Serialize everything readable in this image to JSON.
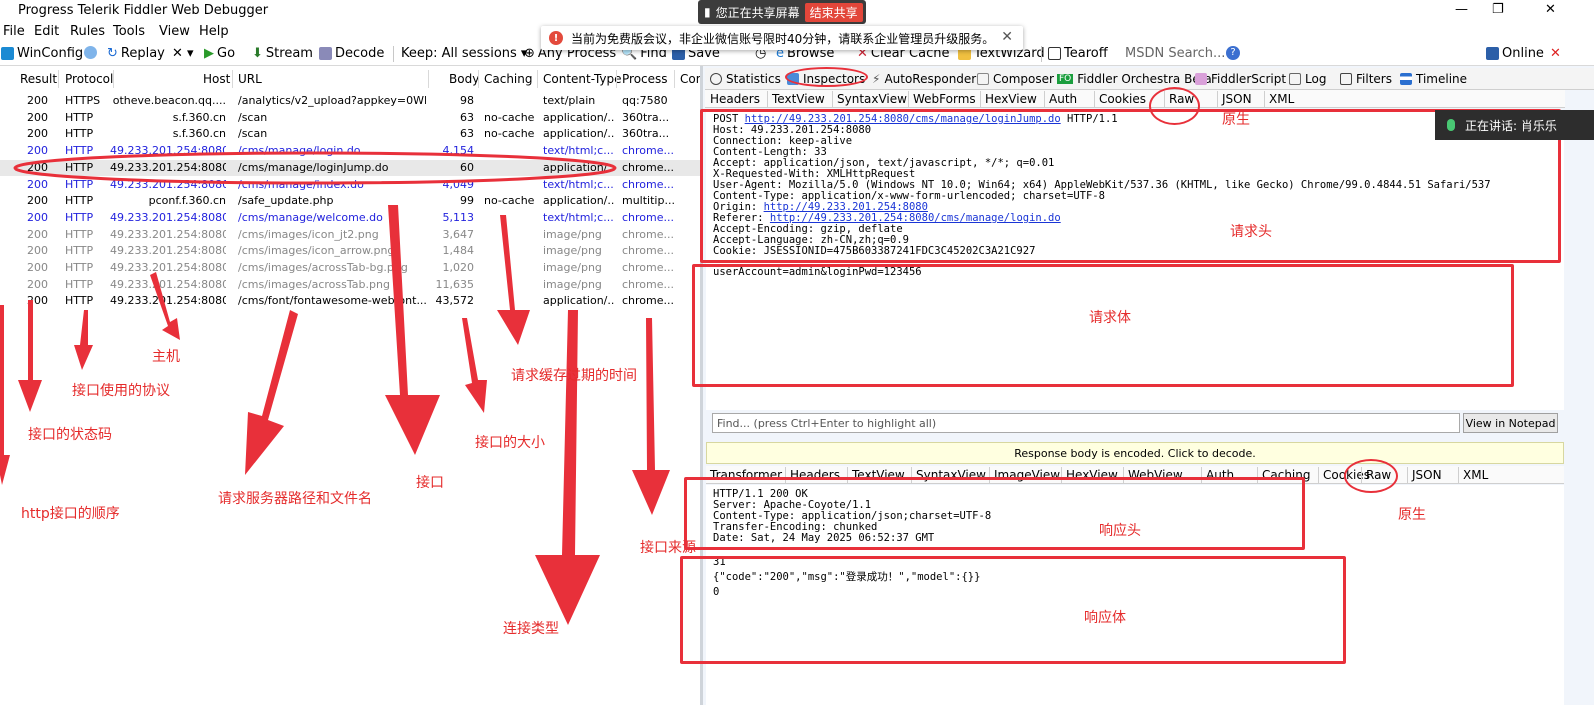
{
  "window": {
    "title": "Progress Telerik Fiddler Web Debugger",
    "controls": [
      "—",
      "❐",
      "✕"
    ]
  },
  "menu": [
    "File",
    "Edit",
    "Rules",
    "Tools",
    "View",
    "Help"
  ],
  "toolbar": {
    "winconfig": "WinConfig",
    "replay": "Replay",
    "remove": "✕ ▾",
    "go": "Go",
    "stream": "Stream",
    "decode": "Decode",
    "keep": "Keep: All sessions ▾",
    "process": "Any Process",
    "find": "Find",
    "save": "Save",
    "browse": "Browse",
    "clear_cache": "Clear Cache",
    "textwizard": "TextWizard",
    "tearoff": "Tearoff",
    "msdn_search": "MSDN Search...",
    "online": "Online"
  },
  "share_bar": {
    "label": "您正在共享屏幕",
    "end_button": "结束共享"
  },
  "notice": {
    "icon": "!",
    "text": "当前为免费版会议，非企业微信账号限时40分钟，请联系企业管理员升级服务。",
    "close": "✕"
  },
  "sessions": {
    "columns": [
      "Result",
      "Protocol",
      "Host",
      "URL",
      "Body",
      "Caching",
      "Content-Type",
      "Process",
      "Com"
    ],
    "rows": [
      {
        "result": "200",
        "protocol": "HTTPS",
        "host": "otheve.beacon.qq....",
        "url": "/analytics/v2_upload?appkey=0WE...",
        "body": "98",
        "caching": "",
        "content_type": "text/plain",
        "process": "qq:7580",
        "style": "normal"
      },
      {
        "result": "200",
        "protocol": "HTTP",
        "host": "s.f.360.cn",
        "url": "/scan",
        "body": "63",
        "caching": "no-cache",
        "content_type": "application/...",
        "process": "360tra...",
        "style": "normal"
      },
      {
        "result": "200",
        "protocol": "HTTP",
        "host": "s.f.360.cn",
        "url": "/scan",
        "body": "63",
        "caching": "no-cache",
        "content_type": "application/...",
        "process": "360tra...",
        "style": "normal"
      },
      {
        "result": "200",
        "protocol": "HTTP",
        "host": "49.233.201.254:8080",
        "url": "/cms/manage/login.do",
        "body": "4,154",
        "caching": "",
        "content_type": "text/html;c...",
        "process": "chrome...",
        "style": "blue"
      },
      {
        "result": "200",
        "protocol": "HTTP",
        "host": "49.233.201.254:8080",
        "url": "/cms/manage/loginJump.do",
        "body": "60",
        "caching": "",
        "content_type": "application/...",
        "process": "chrome...",
        "style": "selected"
      },
      {
        "result": "200",
        "protocol": "HTTP",
        "host": "49.233.201.254:8080",
        "url": "/cms/manage/index.do",
        "body": "4,049",
        "caching": "",
        "content_type": "text/html;c...",
        "process": "chrome...",
        "style": "blue"
      },
      {
        "result": "200",
        "protocol": "HTTP",
        "host": "pconf.f.360.cn",
        "url": "/safe_update.php",
        "body": "99",
        "caching": "no-cache",
        "content_type": "application/...",
        "process": "multitip...",
        "style": "normal"
      },
      {
        "result": "200",
        "protocol": "HTTP",
        "host": "49.233.201.254:8080",
        "url": "/cms/manage/welcome.do",
        "body": "5,113",
        "caching": "",
        "content_type": "text/html;c...",
        "process": "chrome...",
        "style": "blue"
      },
      {
        "result": "200",
        "protocol": "HTTP",
        "host": "49.233.201.254:8080",
        "url": "/cms/images/icon_jt2.png",
        "body": "3,647",
        "caching": "",
        "content_type": "image/png",
        "process": "chrome...",
        "style": "gray"
      },
      {
        "result": "200",
        "protocol": "HTTP",
        "host": "49.233.201.254:8080",
        "url": "/cms/images/icon_arrow.png",
        "body": "1,484",
        "caching": "",
        "content_type": "image/png",
        "process": "chrome...",
        "style": "gray"
      },
      {
        "result": "200",
        "protocol": "HTTP",
        "host": "49.233.201.254:8080",
        "url": "/cms/images/acrossTab-bg.png",
        "body": "1,020",
        "caching": "",
        "content_type": "image/png",
        "process": "chrome...",
        "style": "gray"
      },
      {
        "result": "200",
        "protocol": "HTTP",
        "host": "49.233.201.254:8080",
        "url": "/cms/images/acrossTab.png",
        "body": "11,635",
        "caching": "",
        "content_type": "image/png",
        "process": "chrome...",
        "style": "gray"
      },
      {
        "result": "200",
        "protocol": "HTTP",
        "host": "49.233.201.254:8080",
        "url": "/cms/font/fontawesome-webfont...",
        "body": "43,572",
        "caching": "",
        "content_type": "application/...",
        "process": "chrome...",
        "style": "normal"
      }
    ]
  },
  "annotations": {
    "host": "主机",
    "protocol": "接口使用的协议",
    "status": "接口的状态码",
    "order": "http接口的顺序",
    "path": "请求服务器路径和文件名",
    "api": "接口",
    "size": "接口的大小",
    "cache": "请求缓存过期的时间",
    "content_type": "连接类型",
    "source": "接口来源",
    "raw_req": "原生",
    "req_header": "请求头",
    "req_body": "请求体",
    "resp_header": "响应头",
    "raw_resp": "原生",
    "resp_body": "响应体"
  },
  "inspector": {
    "top_tabs": [
      "Statistics",
      "Inspectors",
      "AutoResponder",
      "Composer",
      "Fiddler Orchestra Beta",
      "FiddlerScript",
      "Log",
      "Filters",
      "Timeline"
    ],
    "request_tabs": [
      "Headers",
      "TextView",
      "SyntaxView",
      "WebForms",
      "HexView",
      "Auth",
      "Cookies",
      "Raw",
      "JSON",
      "XML"
    ],
    "request_raw": {
      "method": "POST",
      "url": "http://49.233.201.254:8080/cms/manage/loginJump.do",
      "version": "HTTP/1.1",
      "lines": [
        "Host: 49.233.201.254:8080",
        "Connection: keep-alive",
        "Content-Length: 33",
        "Accept: application/json, text/javascript, */*; q=0.01",
        "X-Requested-With: XMLHttpRequest",
        "User-Agent: Mozilla/5.0 (Windows NT 10.0; Win64; x64) AppleWebKit/537.36 (KHTML, like Gecko) Chrome/99.0.4844.51 Safari/537",
        "Content-Type: application/x-www-form-urlencoded; charset=UTF-8"
      ],
      "origin_label": "Origin:",
      "origin": "http://49.233.201.254:8080",
      "referer_label": "Referer:",
      "referer": "http://49.233.201.254:8080/cms/manage/login.do",
      "lines2": [
        "Accept-Encoding: gzip, deflate",
        "Accept-Language: zh-CN,zh;q=0.9",
        "Cookie: JSESSIONID=475B603387241FDC3C45202C3A21C927"
      ],
      "body": "userAccount=admin&loginPwd=123456"
    },
    "find_placeholder": "Find... (press Ctrl+Enter to highlight all)",
    "view_in_notepad": "View in Notepad",
    "response_warning": "Response body is encoded. Click to decode.",
    "response_tabs": [
      "Transformer",
      "Headers",
      "TextView",
      "SyntaxView",
      "ImageView",
      "HexView",
      "WebView",
      "Auth",
      "Caching",
      "Cookies",
      "Raw",
      "JSON",
      "XML"
    ],
    "response_raw": {
      "headers": [
        "HTTP/1.1 200 OK",
        "Server: Apache-Coyote/1.1",
        "Content-Type: application/json;charset=UTF-8",
        "Transfer-Encoding: chunked",
        "Date: Sat, 24 May 2025 06:52:37 GMT"
      ],
      "body": [
        "31",
        "{\"code\":\"200\",\"msg\":\"登录成功！\",\"model\":{}}",
        "0"
      ]
    }
  },
  "meeting": {
    "speaking": "正在讲话: 肖乐乐"
  },
  "colors": {
    "annotation_red": "#e8303a",
    "link_blue": "#1a35d6",
    "session_blue": "#2222dd"
  }
}
